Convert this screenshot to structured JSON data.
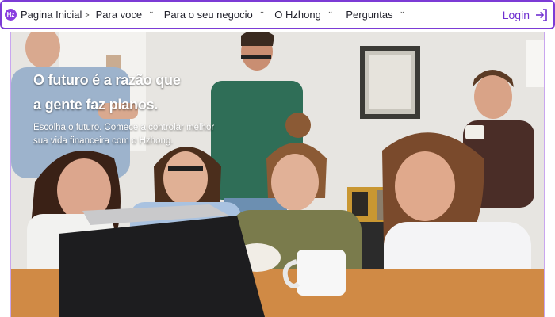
{
  "nav": {
    "logo_text": "Hz",
    "items": [
      {
        "label": "Pagina Inicial"
      },
      {
        "label": "Para voce"
      },
      {
        "label": "Para o seu negocio"
      },
      {
        "label": "O Hzhong"
      },
      {
        "label": "Perguntas"
      }
    ],
    "login_label": "Login",
    "accent_color": "#7c3bd6"
  },
  "hero": {
    "title_line1": "O futuro é a razão que",
    "title_line2": "a gente faz planos.",
    "subtitle_line1": "Escolha o futuro. Comece a controlar melhor",
    "subtitle_line2": "sua vida financeira com o Hzhong."
  }
}
